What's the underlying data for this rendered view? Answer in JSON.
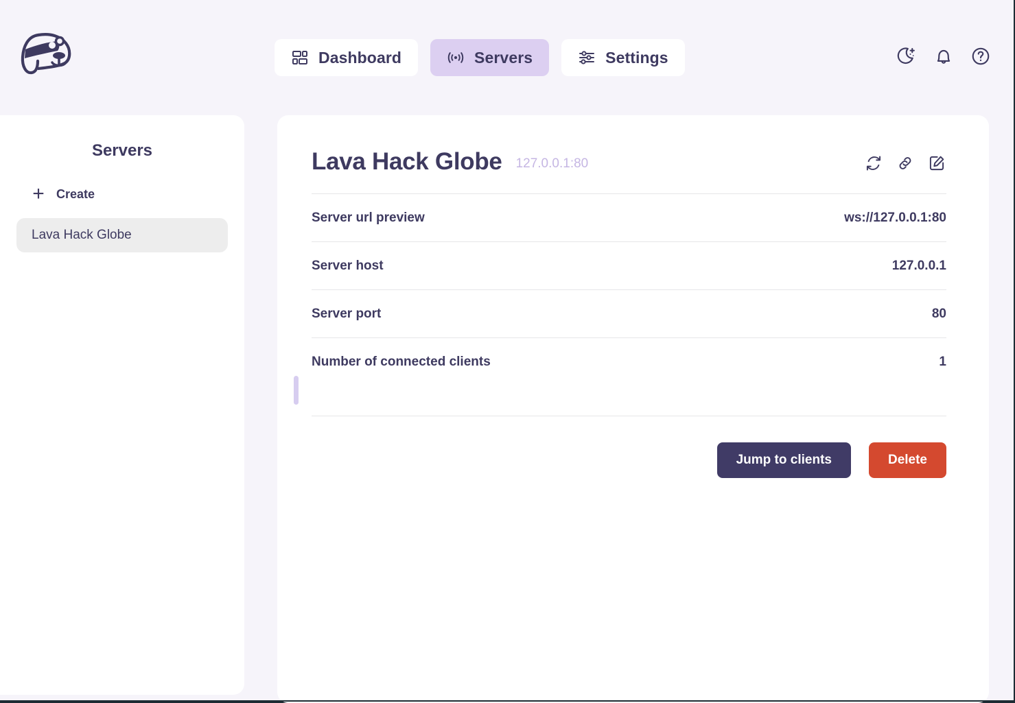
{
  "app": {
    "logo_name": "dog-bandana-logo",
    "background_color": "#f6f4fa",
    "accent_color": "#403b66",
    "active_tab_color": "#dccff1",
    "danger_color": "#d4492f"
  },
  "nav": {
    "tabs": [
      {
        "label": "Dashboard",
        "icon": "dashboard-layout-icon",
        "active": false
      },
      {
        "label": "Servers",
        "icon": "broadcast-signal-icon",
        "active": true
      },
      {
        "label": "Settings",
        "icon": "sliders-icon",
        "active": false
      }
    ]
  },
  "top_actions": [
    {
      "name": "dark-mode-icon",
      "label": "Toggle dark mode"
    },
    {
      "name": "bell-icon",
      "label": "Notifications"
    },
    {
      "name": "help-circle-icon",
      "label": "Help"
    }
  ],
  "sidebar": {
    "title": "Servers",
    "create_label": "Create",
    "create_icon": "plus-icon",
    "items": [
      {
        "label": "Lava Hack Globe",
        "selected": true
      }
    ]
  },
  "panel": {
    "title": "Lava Hack Globe",
    "subtitle": "127.0.0.1:80",
    "actions": [
      {
        "name": "refresh-icon",
        "label": "Refresh"
      },
      {
        "name": "link-icon",
        "label": "Copy link"
      },
      {
        "name": "edit-icon",
        "label": "Edit"
      }
    ],
    "rows": [
      {
        "label": "Server url preview",
        "value": "ws://127.0.0.1:80"
      },
      {
        "label": "Server host",
        "value": "127.0.0.1"
      },
      {
        "label": "Server port",
        "value": "80"
      },
      {
        "label": "Number of connected clients",
        "value": "1"
      }
    ],
    "buttons": {
      "primary_label": "Jump to clients",
      "danger_label": "Delete"
    }
  }
}
